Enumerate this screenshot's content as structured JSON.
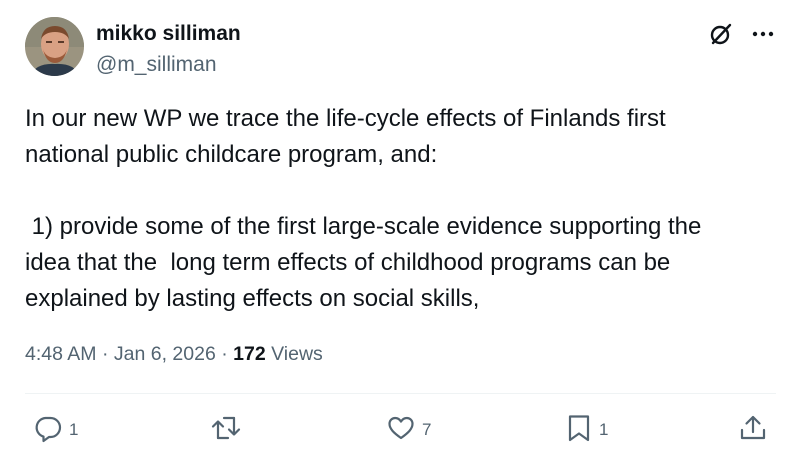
{
  "author": {
    "name": "mikko silliman",
    "handle": "@m_silliman"
  },
  "tweet": {
    "text": "In our new WP we trace the life-cycle effects of Finlands first\nnational public childcare program, and:\n\n 1) provide some of the first large-scale evidence supporting the\nidea that the  long term effects of childhood programs can be\nexplained by lasting effects on social skills,"
  },
  "meta": {
    "time": "4:48 AM",
    "separator": "·",
    "date": "Jan 6, 2026",
    "views_count": "172",
    "views_label": "Views"
  },
  "actions": {
    "replies": "1",
    "likes": "7",
    "bookmarks": "1"
  },
  "icons": {
    "top_right": [
      "grok-icon",
      "more-icon"
    ],
    "actions": [
      "reply-icon",
      "repost-icon",
      "like-icon",
      "bookmark-icon",
      "share-icon"
    ]
  },
  "colors": {
    "text_primary": "#0f1419",
    "text_secondary": "#536471",
    "divider": "#eff3f4"
  }
}
